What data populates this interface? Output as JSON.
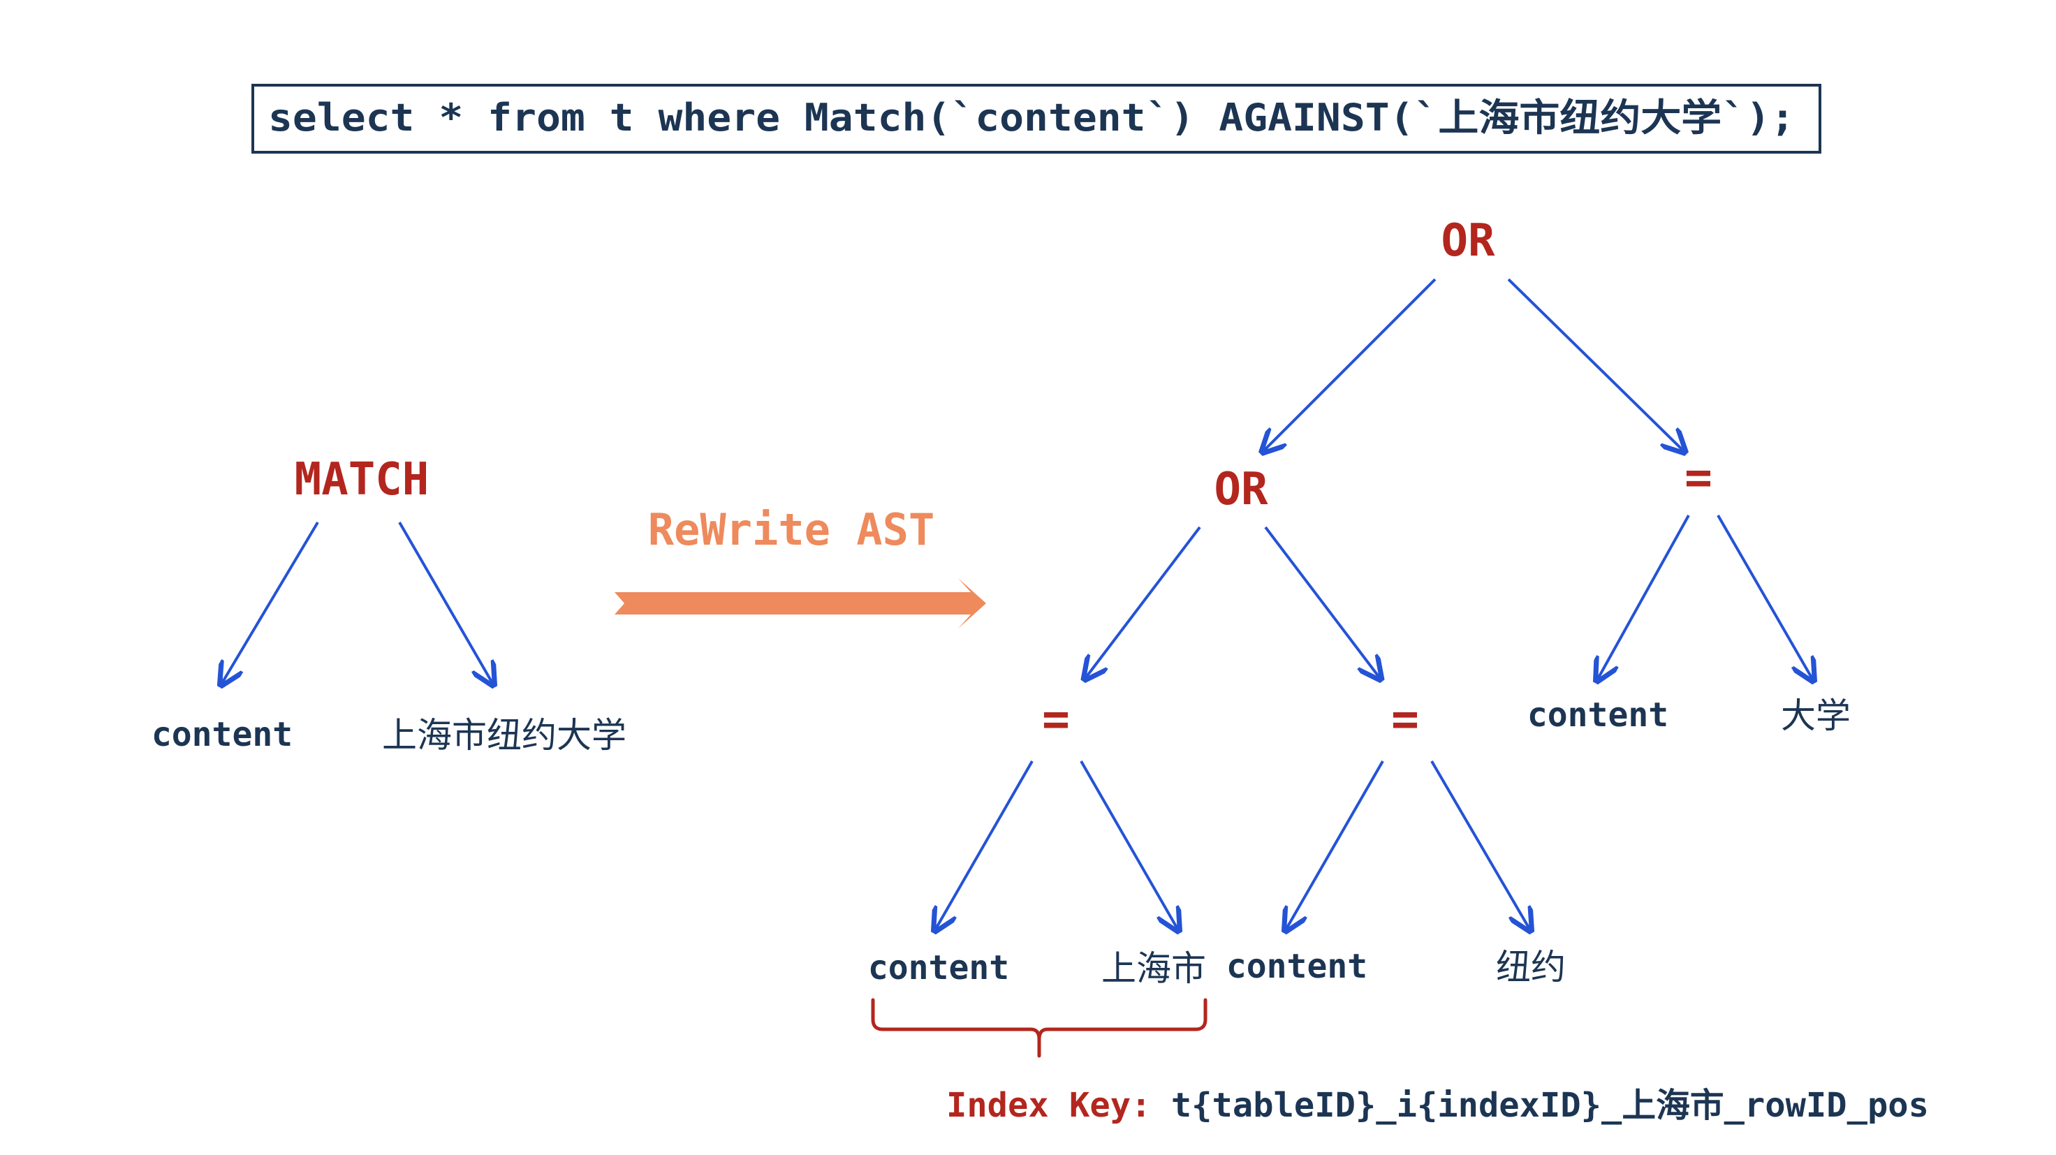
{
  "sql": "select * from t where Match(`content`) AGAINST(`上海市纽约大学`);",
  "original_tree": {
    "root": "MATCH",
    "left": "content",
    "right": "上海市纽约大学"
  },
  "rewrite_label": "ReWrite AST",
  "rewritten_tree": {
    "root": "OR",
    "inner_or": "OR",
    "eq_a": {
      "op": "=",
      "left": "content",
      "right": "上海市"
    },
    "eq_b": {
      "op": "=",
      "left": "content",
      "right": "纽约"
    },
    "eq_c": {
      "op": "=",
      "left": "content",
      "right": "大学"
    }
  },
  "index_key": {
    "label": "Index Key:",
    "value": "t{tableID}_i{indexID}_上海市_rowID_pos"
  },
  "colors": {
    "text": "#1c3553",
    "operator": "#b3261e",
    "edge": "#2453d6",
    "rewrite": "#ee8a5c"
  }
}
